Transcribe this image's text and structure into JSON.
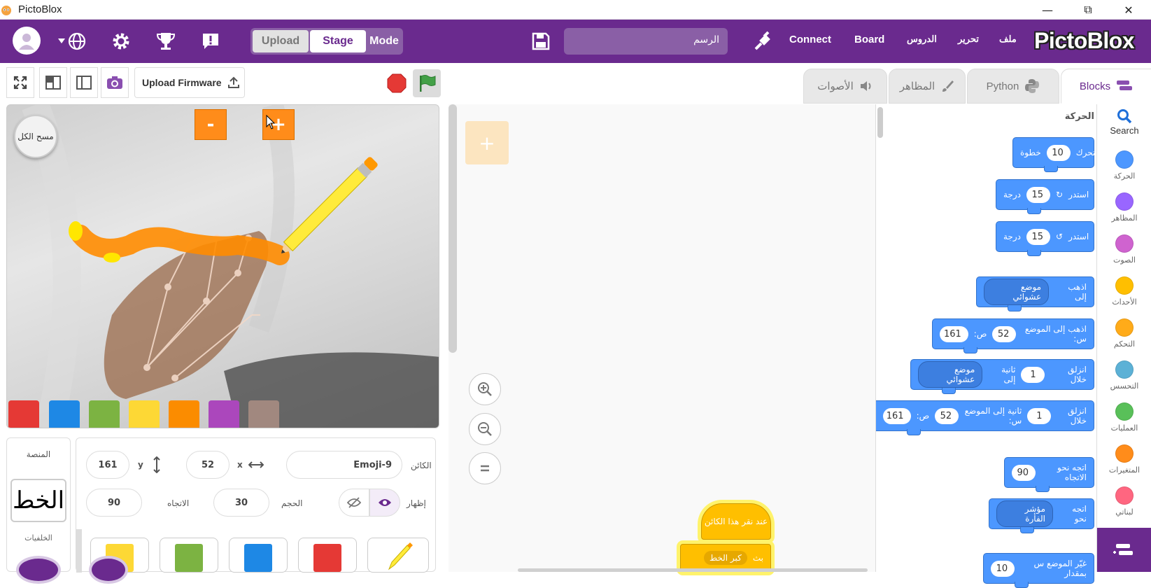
{
  "window": {
    "title": "PictoBlox",
    "minimize": "—",
    "maximize": "⧉",
    "close": "✕"
  },
  "menubar": {
    "mode_toggle": {
      "upload": "Upload",
      "stage": "Stage",
      "mode": "Mode"
    },
    "search_value": "الرسم",
    "connect": "Connect",
    "board": "Board",
    "lessons": "الدروس",
    "edit": "تحرير",
    "file": "ملف",
    "logo": "PictoBlox"
  },
  "toolbar": {
    "upload_firmware": "Upload Firmware"
  },
  "tabs": {
    "sounds": "الأصوات",
    "costumes": "المظاهر",
    "python": "Python",
    "blocks": "Blocks"
  },
  "stage": {
    "clear_all": "مسح الكل",
    "minus": "-",
    "plus": "+"
  },
  "color_palette": [
    "#e53935",
    "#1e88e5",
    "#7cb342",
    "#fdd835",
    "#fb8c00",
    "#ab47bc",
    "#a1887f"
  ],
  "stage_panel": {
    "title": "المنصة",
    "backdrop_preview": "الخط",
    "backdrops": "الخلفيات"
  },
  "sprite_panel": {
    "sprite_label": "الكائن",
    "sprite_name": "Emoji-9",
    "x_label": "x",
    "x_value": "52",
    "y_label": "y",
    "y_value": "161",
    "show_label": "إظهار",
    "size_label": "الحجم",
    "size_value": "30",
    "direction_label": "الاتجاه",
    "direction_value": "90"
  },
  "palette": {
    "category_title": "الحركة",
    "blocks": {
      "move": {
        "text": "تحرك",
        "value": "10",
        "suffix": "خطوة"
      },
      "turn_right": {
        "text": "استدر",
        "value": "15",
        "suffix": "درجة"
      },
      "turn_left": {
        "text": "استدر",
        "value": "15",
        "suffix": "درجة"
      },
      "goto": {
        "text": "اذهب إلى",
        "drop": "موضع عشوائي"
      },
      "goto_xy": {
        "text": "اذهب إلى الموضع س:",
        "x": "52",
        "y_label": "ص:",
        "y": "161"
      },
      "glide": {
        "text": "انزلق خلال",
        "value": "1",
        "mid": "ثانية إلى",
        "drop": "موضع عشوائي"
      },
      "glide_xy": {
        "text": "انزلق خلال",
        "value": "1",
        "mid": "ثانية إلى الموضع س:",
        "x": "52",
        "y_label": "ص:",
        "y": "161"
      },
      "point_dir": {
        "text": "اتجه نحو الاتجاه",
        "value": "90"
      },
      "point_towards": {
        "text": "اتجه نحو",
        "drop": "مؤشر الفأرة"
      },
      "change_x": {
        "text": "غيّر الموضع س بمقدار",
        "value": "10"
      }
    }
  },
  "categories": [
    {
      "name": "Search",
      "color": ""
    },
    {
      "name": "الحركة",
      "color": "#4c97ff"
    },
    {
      "name": "المظاهر",
      "color": "#9966ff"
    },
    {
      "name": "الصوت",
      "color": "#cf63cf"
    },
    {
      "name": "الأحداث",
      "color": "#ffbf00"
    },
    {
      "name": "التحكم",
      "color": "#ffab19"
    },
    {
      "name": "التحسس",
      "color": "#5cb1d6"
    },
    {
      "name": "العمليات",
      "color": "#59c059"
    },
    {
      "name": "المتغيرات",
      "color": "#ff8c1a"
    },
    {
      "name": "لبناتي",
      "color": "#ff6680"
    }
  ],
  "scripts": {
    "hat_text": "عند نقر هذا الكائن",
    "stamp_prefix": "بث",
    "stamp_drop": "كبر الخط"
  }
}
